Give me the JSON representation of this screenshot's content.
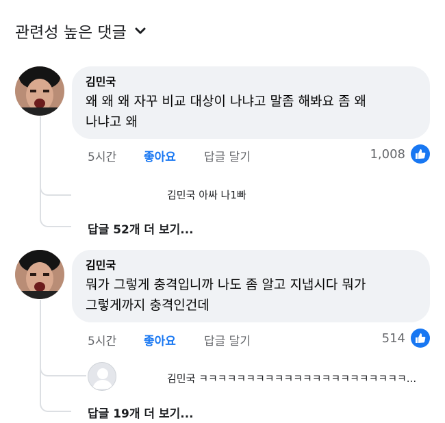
{
  "header": {
    "sort_label": "관련성 높은 댓글"
  },
  "comments": [
    {
      "author": "김민국",
      "text_line1": "왜 왜 왜 자꾸 비교 대상이 나냐고 말좀 해봐요 좀 왜",
      "text_line2": "나냐고 왜",
      "time": "5시간",
      "like_label": "좋아요",
      "reply_label": "답글 달기",
      "reaction_count": "1,008",
      "reply_preview": {
        "author": "김민국",
        "text": "아싸 나1빠"
      },
      "more_replies": "답글 52개 더 보기..."
    },
    {
      "author": "김민국",
      "text_line1": "뭐가 그렇게 충격입니까 나도 좀 알고 지냅시다 뭐가",
      "text_line2": "그렇게까지 충격인건데",
      "time": "5시간",
      "like_label": "좋아요",
      "reply_label": "답글 달기",
      "reaction_count": "514",
      "reply_preview": {
        "author": "김민국",
        "text": "ㅋㅋㅋㅋㅋㅋㅋㅋㅋㅋㅋㅋㅋㅋㅋㅋㅋㅋㅋㅋㅋㅋ..."
      },
      "more_replies": "답글 19개 더 보기..."
    }
  ],
  "colors": {
    "accent": "#1877f2",
    "bubble": "#f0f2f5",
    "muted": "#65676b"
  },
  "icons": {
    "sort": "chevron-down-icon",
    "reaction": "thumbs-up-icon",
    "avatar": "user-avatar-icon"
  }
}
